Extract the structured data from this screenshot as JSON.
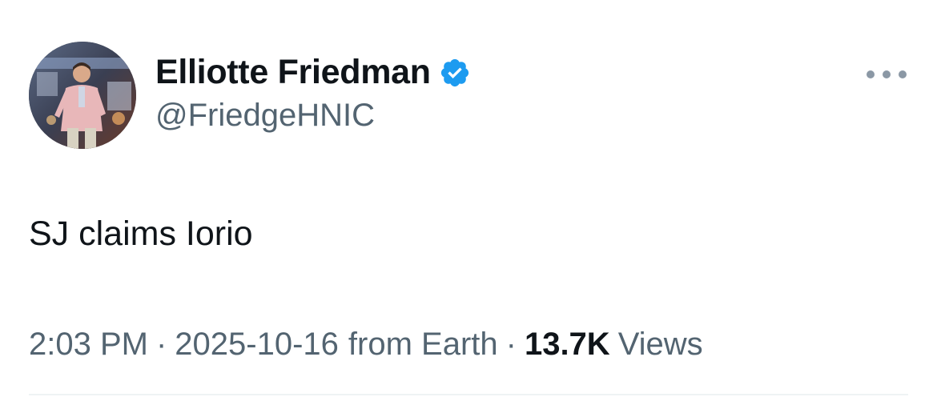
{
  "author": {
    "display_name": "Elliotte Friedman",
    "handle": "@FriedgeHNIC",
    "verified": true
  },
  "tweet": {
    "text": "SJ claims Iorio"
  },
  "meta": {
    "time": "2:03 PM",
    "separator": "·",
    "date": "2025-10-16",
    "source": "from Earth",
    "views_count": "13.7K",
    "views_label": "Views"
  },
  "icons": {
    "verified": "verified-badge-icon",
    "more": "more-horizontal-icon"
  },
  "colors": {
    "text_primary": "#0f1419",
    "text_secondary": "#536471",
    "verified_blue": "#1d9bf0",
    "divider": "#eff3f4"
  }
}
